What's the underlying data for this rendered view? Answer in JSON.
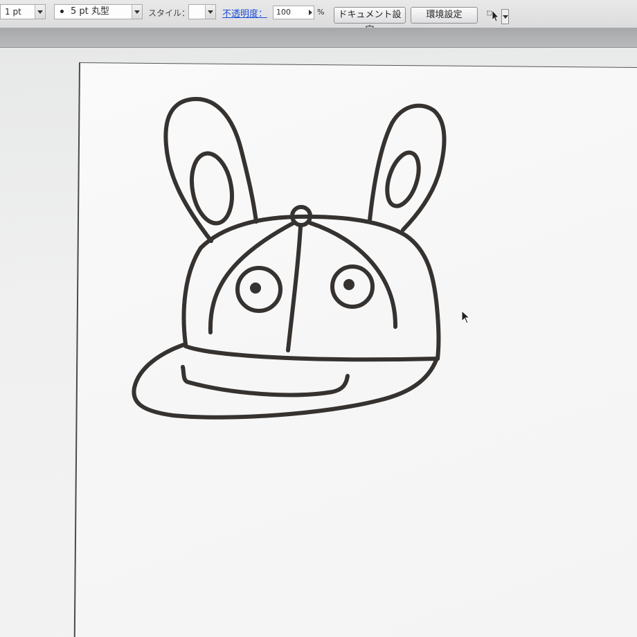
{
  "control_bar": {
    "stroke_weight": "1 pt",
    "brush": "5 pt 丸型",
    "style_label": "スタイル：",
    "opacity_label": "不透明度：",
    "opacity_value": "100",
    "percent": "%",
    "document_setup_button": "ドキュメント設定",
    "preferences_button": "環境設定"
  },
  "colors": {
    "accent_link": "#1b4fd6",
    "stroke": "#353230"
  },
  "icons": {
    "tool_icon": "selection-tool-icon",
    "cursor": "arrow-cursor-icon"
  },
  "artwork": {
    "subject": "rabbit-with-cap-drawing"
  }
}
